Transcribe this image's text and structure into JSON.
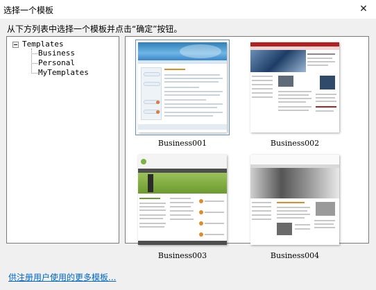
{
  "window": {
    "title": "选择一个模板",
    "close_glyph": "✕"
  },
  "instruction": "从下方列表中选择一个模板并点击“确定”按钮。",
  "tree": {
    "root_label": "Templates",
    "items": [
      {
        "label": "Business"
      },
      {
        "label": "Personal"
      },
      {
        "label": "MyTemplates"
      }
    ]
  },
  "templates": [
    {
      "label": "Business001",
      "selected": true
    },
    {
      "label": "Business002",
      "selected": false
    },
    {
      "label": "Business003",
      "selected": false
    },
    {
      "label": "Business004",
      "selected": false
    }
  ],
  "more_link": "供注册用户使用的更多模板...",
  "colors": {
    "link": "#0066cc",
    "selection_border": "#5b8ed6"
  },
  "icons": {
    "close": "close-icon",
    "tree_collapse": "minus-box-icon"
  }
}
